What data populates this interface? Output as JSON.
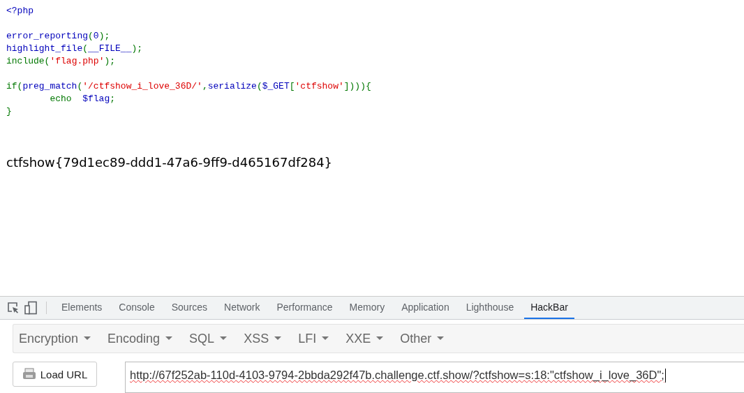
{
  "code_lines": [
    {
      "kind": "code",
      "tokens": [
        {
          "text": "<?php",
          "kind": "default"
        }
      ]
    },
    {
      "kind": "blank"
    },
    {
      "kind": "code",
      "tokens": [
        {
          "text": "error_reporting",
          "kind": "default"
        },
        {
          "text": "(",
          "kind": "keyword"
        },
        {
          "text": "0",
          "kind": "default"
        },
        {
          "text": ");",
          "kind": "keyword"
        }
      ]
    },
    {
      "kind": "code",
      "tokens": [
        {
          "text": "highlight_file",
          "kind": "default"
        },
        {
          "text": "(",
          "kind": "keyword"
        },
        {
          "text": "__FILE__",
          "kind": "default"
        },
        {
          "text": ");",
          "kind": "keyword"
        }
      ]
    },
    {
      "kind": "code",
      "tokens": [
        {
          "text": "include(",
          "kind": "keyword"
        },
        {
          "text": "'flag.php'",
          "kind": "string"
        },
        {
          "text": ");",
          "kind": "keyword"
        }
      ]
    },
    {
      "kind": "blank"
    },
    {
      "kind": "code",
      "tokens": [
        {
          "text": "if(",
          "kind": "keyword"
        },
        {
          "text": "preg_match",
          "kind": "default"
        },
        {
          "text": "(",
          "kind": "keyword"
        },
        {
          "text": "'/ctfshow_i_love_36D/'",
          "kind": "string"
        },
        {
          "text": ",",
          "kind": "keyword"
        },
        {
          "text": "serialize",
          "kind": "default"
        },
        {
          "text": "(",
          "kind": "keyword"
        },
        {
          "text": "$_GET",
          "kind": "default"
        },
        {
          "text": "[",
          "kind": "keyword"
        },
        {
          "text": "'ctfshow'",
          "kind": "string"
        },
        {
          "text": "]))){",
          "kind": "keyword"
        }
      ]
    },
    {
      "kind": "code",
      "tokens": [
        {
          "text": "        echo  ",
          "kind": "keyword"
        },
        {
          "text": "$flag",
          "kind": "default"
        },
        {
          "text": ";",
          "kind": "keyword"
        }
      ]
    },
    {
      "kind": "code",
      "tokens": [
        {
          "text": "}",
          "kind": "keyword"
        }
      ]
    }
  ],
  "output": "ctfshow{79d1ec89-ddd1-47a6-9ff9-d465167df284}",
  "devtools": {
    "tabs": [
      {
        "label": "Elements",
        "selected": false
      },
      {
        "label": "Console",
        "selected": false
      },
      {
        "label": "Sources",
        "selected": false
      },
      {
        "label": "Network",
        "selected": false
      },
      {
        "label": "Performance",
        "selected": false
      },
      {
        "label": "Memory",
        "selected": false
      },
      {
        "label": "Application",
        "selected": false
      },
      {
        "label": "Lighthouse",
        "selected": false
      },
      {
        "label": "HackBar",
        "selected": true
      }
    ]
  },
  "hackbar": {
    "menus": [
      "Encryption",
      "Encoding",
      "SQL",
      "XSS",
      "LFI",
      "XXE",
      "Other"
    ],
    "load_button": "Load URL",
    "url": "http://67f252ab-110d-4103-9794-2bbda292f47b.challenge.ctf.show/?ctfshow=s:18:\"ctfshow_i_love_36D\";"
  }
}
